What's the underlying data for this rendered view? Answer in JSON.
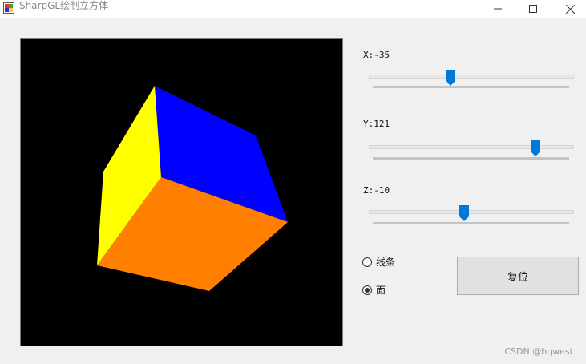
{
  "window": {
    "title": "SharpGL绘制立方体",
    "minimize_icon": "minimize-icon",
    "maximize_icon": "maximize-icon",
    "close_icon": "close-icon"
  },
  "viewport": {
    "background": "#000000",
    "face_colors": {
      "top": "#0000ff",
      "left": "#ffff00",
      "front": "#ff8000"
    }
  },
  "sliders": [
    {
      "label": "X:-35",
      "axis": "x",
      "value": -35,
      "fraction": 0.4
    },
    {
      "label": "Y:121",
      "axis": "y",
      "value": 121,
      "fraction": 0.82
    },
    {
      "label": "Z:-10",
      "axis": "z",
      "value": -10,
      "fraction": 0.47
    }
  ],
  "render_mode": {
    "options": [
      {
        "label": "线条",
        "checked": false
      },
      {
        "label": "面",
        "checked": true
      }
    ]
  },
  "reset_button": {
    "label": "复位"
  },
  "watermark": "CSDN @hqwest",
  "colors": {
    "slider_thumb": "#0078d7"
  }
}
